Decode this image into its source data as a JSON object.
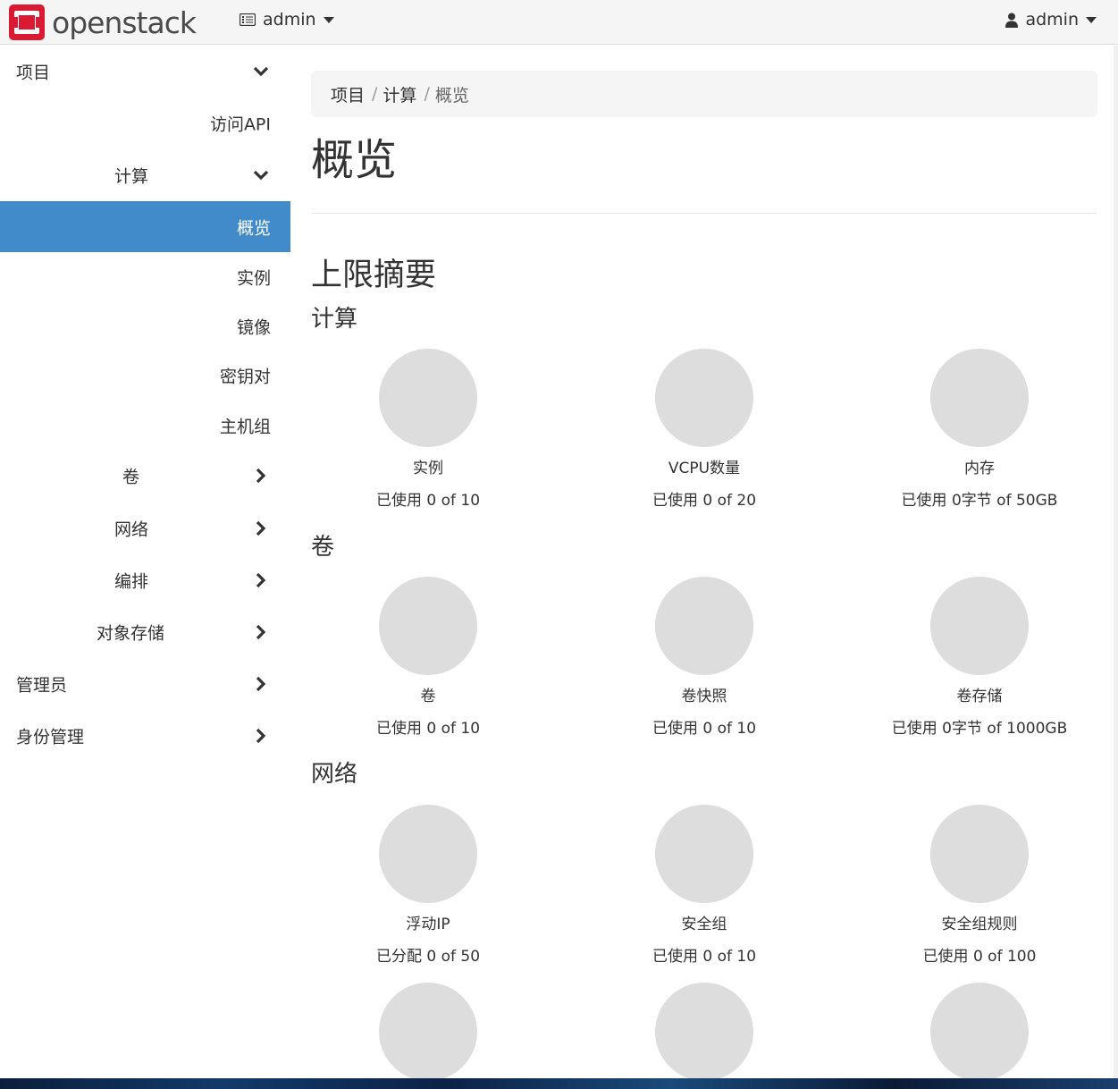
{
  "brand": {
    "name": "openstack",
    "accent": "#da1a32",
    "tm": "."
  },
  "topbar": {
    "project_menu": {
      "icon": "server-icon",
      "label": "admin"
    },
    "user_menu": {
      "icon": "user-icon",
      "label": "admin"
    }
  },
  "sidebar": {
    "project": "项目",
    "api_access": "访问API",
    "compute": "计算",
    "overview": "概览",
    "instances": "实例",
    "images": "镜像",
    "keypairs": "密钥对",
    "server_groups": "主机组",
    "volumes": "卷",
    "network": "网络",
    "orchestration": "编排",
    "object_store": "对象存储",
    "admin": "管理员",
    "identity": "身份管理",
    "active_color": "#428bca"
  },
  "breadcrumb": {
    "items": [
      "项目",
      "计算",
      "概览"
    ],
    "separator": "/"
  },
  "page": {
    "title": "概览",
    "summary_heading": "上限摘要"
  },
  "sections": [
    {
      "title": "计算",
      "quotas": [
        {
          "label": "实例",
          "usage": "已使用 0 of 10"
        },
        {
          "label": "VCPU数量",
          "usage": "已使用 0 of 20"
        },
        {
          "label": "内存",
          "usage": "已使用 0字节 of 50GB"
        }
      ]
    },
    {
      "title": "卷",
      "quotas": [
        {
          "label": "卷",
          "usage": "已使用 0 of 10"
        },
        {
          "label": "卷快照",
          "usage": "已使用 0 of 10"
        },
        {
          "label": "卷存储",
          "usage": "已使用 0字节 of 1000GB"
        }
      ]
    },
    {
      "title": "网络",
      "quotas": [
        {
          "label": "浮动IP",
          "usage": "已分配 0 of 50"
        },
        {
          "label": "安全组",
          "usage": "已使用 0 of 10"
        },
        {
          "label": "安全组规则",
          "usage": "已使用 0 of 100"
        }
      ]
    }
  ],
  "pie_color": "#dddddd"
}
